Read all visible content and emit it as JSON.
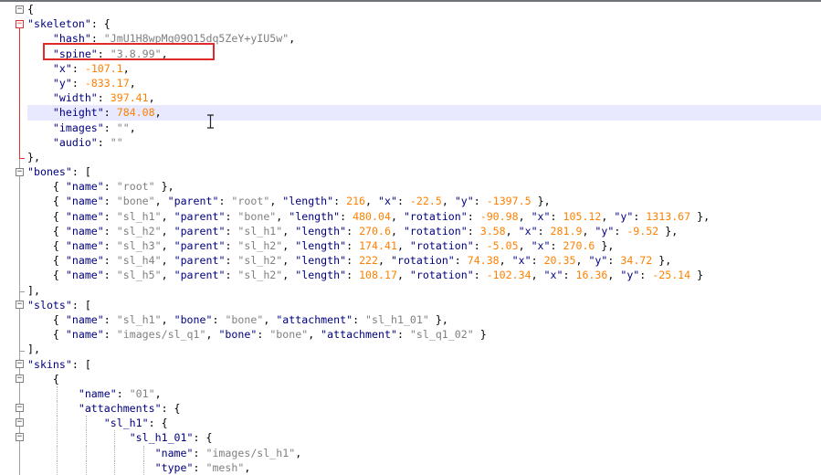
{
  "editor": {
    "lines": [
      {
        "depth": 0,
        "hl": false,
        "tokens": [
          [
            "p",
            "{"
          ]
        ]
      },
      {
        "depth": 0,
        "hl": false,
        "tokens": [
          [
            "k",
            "\"skeleton\""
          ],
          [
            "p",
            ": {"
          ]
        ]
      },
      {
        "depth": 1,
        "hl": false,
        "tokens": [
          [
            "k",
            "\"hash\""
          ],
          [
            "p",
            ": "
          ],
          [
            "s",
            "\"JmU1H8wpMq09O15dq5ZeY+yIU5w\""
          ],
          [
            "p",
            ","
          ]
        ]
      },
      {
        "depth": 1,
        "hl": false,
        "tokens": [
          [
            "k",
            "\"spine\""
          ],
          [
            "p",
            ": "
          ],
          [
            "s",
            "\"3.8.99\""
          ],
          [
            "p",
            ","
          ]
        ]
      },
      {
        "depth": 1,
        "hl": false,
        "tokens": [
          [
            "k",
            "\"x\""
          ],
          [
            "p",
            ": "
          ],
          [
            "n",
            "-107.1"
          ],
          [
            "p",
            ","
          ]
        ]
      },
      {
        "depth": 1,
        "hl": false,
        "tokens": [
          [
            "k",
            "\"y\""
          ],
          [
            "p",
            ": "
          ],
          [
            "n",
            "-833.17"
          ],
          [
            "p",
            ","
          ]
        ]
      },
      {
        "depth": 1,
        "hl": false,
        "tokens": [
          [
            "k",
            "\"width\""
          ],
          [
            "p",
            ": "
          ],
          [
            "n",
            "397.41"
          ],
          [
            "p",
            ","
          ]
        ]
      },
      {
        "depth": 1,
        "hl": true,
        "tokens": [
          [
            "k",
            "\"height\""
          ],
          [
            "p",
            ": "
          ],
          [
            "n",
            "784.08"
          ],
          [
            "p",
            ","
          ]
        ]
      },
      {
        "depth": 1,
        "hl": false,
        "tokens": [
          [
            "k",
            "\"images\""
          ],
          [
            "p",
            ": "
          ],
          [
            "s",
            "\"\""
          ],
          [
            "p",
            ","
          ]
        ]
      },
      {
        "depth": 1,
        "hl": false,
        "tokens": [
          [
            "k",
            "\"audio\""
          ],
          [
            "p",
            ": "
          ],
          [
            "s",
            "\"\""
          ]
        ]
      },
      {
        "depth": 0,
        "hl": false,
        "tokens": [
          [
            "p",
            "},"
          ]
        ]
      },
      {
        "depth": 0,
        "hl": false,
        "tokens": [
          [
            "k",
            "\"bones\""
          ],
          [
            "p",
            ": ["
          ]
        ]
      },
      {
        "depth": 1,
        "hl": false,
        "tokens": [
          [
            "p",
            "{ "
          ],
          [
            "k",
            "\"name\""
          ],
          [
            "p",
            ": "
          ],
          [
            "s",
            "\"root\""
          ],
          [
            "p",
            " },"
          ]
        ]
      },
      {
        "depth": 1,
        "hl": false,
        "tokens": [
          [
            "p",
            "{ "
          ],
          [
            "k",
            "\"name\""
          ],
          [
            "p",
            ": "
          ],
          [
            "s",
            "\"bone\""
          ],
          [
            "p",
            ", "
          ],
          [
            "k",
            "\"parent\""
          ],
          [
            "p",
            ": "
          ],
          [
            "s",
            "\"root\""
          ],
          [
            "p",
            ", "
          ],
          [
            "k",
            "\"length\""
          ],
          [
            "p",
            ": "
          ],
          [
            "n",
            "216"
          ],
          [
            "p",
            ", "
          ],
          [
            "k",
            "\"x\""
          ],
          [
            "p",
            ": "
          ],
          [
            "n",
            "-22.5"
          ],
          [
            "p",
            ", "
          ],
          [
            "k",
            "\"y\""
          ],
          [
            "p",
            ": "
          ],
          [
            "n",
            "-1397.5"
          ],
          [
            "p",
            " },"
          ]
        ]
      },
      {
        "depth": 1,
        "hl": false,
        "tokens": [
          [
            "p",
            "{ "
          ],
          [
            "k",
            "\"name\""
          ],
          [
            "p",
            ": "
          ],
          [
            "s",
            "\"sl_h1\""
          ],
          [
            "p",
            ", "
          ],
          [
            "k",
            "\"parent\""
          ],
          [
            "p",
            ": "
          ],
          [
            "s",
            "\"bone\""
          ],
          [
            "p",
            ", "
          ],
          [
            "k",
            "\"length\""
          ],
          [
            "p",
            ": "
          ],
          [
            "n",
            "480.04"
          ],
          [
            "p",
            ", "
          ],
          [
            "k",
            "\"rotation\""
          ],
          [
            "p",
            ": "
          ],
          [
            "n",
            "-90.98"
          ],
          [
            "p",
            ", "
          ],
          [
            "k",
            "\"x\""
          ],
          [
            "p",
            ": "
          ],
          [
            "n",
            "105.12"
          ],
          [
            "p",
            ", "
          ],
          [
            "k",
            "\"y\""
          ],
          [
            "p",
            ": "
          ],
          [
            "n",
            "1313.67"
          ],
          [
            "p",
            " },"
          ]
        ]
      },
      {
        "depth": 1,
        "hl": false,
        "tokens": [
          [
            "p",
            "{ "
          ],
          [
            "k",
            "\"name\""
          ],
          [
            "p",
            ": "
          ],
          [
            "s",
            "\"sl_h2\""
          ],
          [
            "p",
            ", "
          ],
          [
            "k",
            "\"parent\""
          ],
          [
            "p",
            ": "
          ],
          [
            "s",
            "\"sl_h1\""
          ],
          [
            "p",
            ", "
          ],
          [
            "k",
            "\"length\""
          ],
          [
            "p",
            ": "
          ],
          [
            "n",
            "270.6"
          ],
          [
            "p",
            ", "
          ],
          [
            "k",
            "\"rotation\""
          ],
          [
            "p",
            ": "
          ],
          [
            "n",
            "3.58"
          ],
          [
            "p",
            ", "
          ],
          [
            "k",
            "\"x\""
          ],
          [
            "p",
            ": "
          ],
          [
            "n",
            "281.9"
          ],
          [
            "p",
            ", "
          ],
          [
            "k",
            "\"y\""
          ],
          [
            "p",
            ": "
          ],
          [
            "n",
            "-9.52"
          ],
          [
            "p",
            " },"
          ]
        ]
      },
      {
        "depth": 1,
        "hl": false,
        "tokens": [
          [
            "p",
            "{ "
          ],
          [
            "k",
            "\"name\""
          ],
          [
            "p",
            ": "
          ],
          [
            "s",
            "\"sl_h3\""
          ],
          [
            "p",
            ", "
          ],
          [
            "k",
            "\"parent\""
          ],
          [
            "p",
            ": "
          ],
          [
            "s",
            "\"sl_h2\""
          ],
          [
            "p",
            ", "
          ],
          [
            "k",
            "\"length\""
          ],
          [
            "p",
            ": "
          ],
          [
            "n",
            "174.41"
          ],
          [
            "p",
            ", "
          ],
          [
            "k",
            "\"rotation\""
          ],
          [
            "p",
            ": "
          ],
          [
            "n",
            "-5.05"
          ],
          [
            "p",
            ", "
          ],
          [
            "k",
            "\"x\""
          ],
          [
            "p",
            ": "
          ],
          [
            "n",
            "270.6"
          ],
          [
            "p",
            " },"
          ]
        ]
      },
      {
        "depth": 1,
        "hl": false,
        "tokens": [
          [
            "p",
            "{ "
          ],
          [
            "k",
            "\"name\""
          ],
          [
            "p",
            ": "
          ],
          [
            "s",
            "\"sl_h4\""
          ],
          [
            "p",
            ", "
          ],
          [
            "k",
            "\"parent\""
          ],
          [
            "p",
            ": "
          ],
          [
            "s",
            "\"sl_h2\""
          ],
          [
            "p",
            ", "
          ],
          [
            "k",
            "\"length\""
          ],
          [
            "p",
            ": "
          ],
          [
            "n",
            "222"
          ],
          [
            "p",
            ", "
          ],
          [
            "k",
            "\"rotation\""
          ],
          [
            "p",
            ": "
          ],
          [
            "n",
            "74.38"
          ],
          [
            "p",
            ", "
          ],
          [
            "k",
            "\"x\""
          ],
          [
            "p",
            ": "
          ],
          [
            "n",
            "20.35"
          ],
          [
            "p",
            ", "
          ],
          [
            "k",
            "\"y\""
          ],
          [
            "p",
            ": "
          ],
          [
            "n",
            "34.72"
          ],
          [
            "p",
            " },"
          ]
        ]
      },
      {
        "depth": 1,
        "hl": false,
        "tokens": [
          [
            "p",
            "{ "
          ],
          [
            "k",
            "\"name\""
          ],
          [
            "p",
            ": "
          ],
          [
            "s",
            "\"sl_h5\""
          ],
          [
            "p",
            ", "
          ],
          [
            "k",
            "\"parent\""
          ],
          [
            "p",
            ": "
          ],
          [
            "s",
            "\"sl_h2\""
          ],
          [
            "p",
            ", "
          ],
          [
            "k",
            "\"length\""
          ],
          [
            "p",
            ": "
          ],
          [
            "n",
            "108.17"
          ],
          [
            "p",
            ", "
          ],
          [
            "k",
            "\"rotation\""
          ],
          [
            "p",
            ": "
          ],
          [
            "n",
            "-102.34"
          ],
          [
            "p",
            ", "
          ],
          [
            "k",
            "\"x\""
          ],
          [
            "p",
            ": "
          ],
          [
            "n",
            "16.36"
          ],
          [
            "p",
            ", "
          ],
          [
            "k",
            "\"y\""
          ],
          [
            "p",
            ": "
          ],
          [
            "n",
            "-25.14"
          ],
          [
            "p",
            " }"
          ]
        ]
      },
      {
        "depth": 0,
        "hl": false,
        "tokens": [
          [
            "p",
            "],"
          ]
        ]
      },
      {
        "depth": 0,
        "hl": false,
        "tokens": [
          [
            "k",
            "\"slots\""
          ],
          [
            "p",
            ": ["
          ]
        ]
      },
      {
        "depth": 1,
        "hl": false,
        "tokens": [
          [
            "p",
            "{ "
          ],
          [
            "k",
            "\"name\""
          ],
          [
            "p",
            ": "
          ],
          [
            "s",
            "\"sl_h1\""
          ],
          [
            "p",
            ", "
          ],
          [
            "k",
            "\"bone\""
          ],
          [
            "p",
            ": "
          ],
          [
            "s",
            "\"bone\""
          ],
          [
            "p",
            ", "
          ],
          [
            "k",
            "\"attachment\""
          ],
          [
            "p",
            ": "
          ],
          [
            "s",
            "\"sl_h1_01\""
          ],
          [
            "p",
            " },"
          ]
        ]
      },
      {
        "depth": 1,
        "hl": false,
        "tokens": [
          [
            "p",
            "{ "
          ],
          [
            "k",
            "\"name\""
          ],
          [
            "p",
            ": "
          ],
          [
            "s",
            "\"images/sl_q1\""
          ],
          [
            "p",
            ", "
          ],
          [
            "k",
            "\"bone\""
          ],
          [
            "p",
            ": "
          ],
          [
            "s",
            "\"bone\""
          ],
          [
            "p",
            ", "
          ],
          [
            "k",
            "\"attachment\""
          ],
          [
            "p",
            ": "
          ],
          [
            "s",
            "\"sl_q1_02\""
          ],
          [
            "p",
            " }"
          ]
        ]
      },
      {
        "depth": 0,
        "hl": false,
        "tokens": [
          [
            "p",
            "],"
          ]
        ]
      },
      {
        "depth": 0,
        "hl": false,
        "tokens": [
          [
            "k",
            "\"skins\""
          ],
          [
            "p",
            ": ["
          ]
        ]
      },
      {
        "depth": 1,
        "hl": false,
        "tokens": [
          [
            "p",
            "{"
          ]
        ]
      },
      {
        "depth": 2,
        "hl": false,
        "tokens": [
          [
            "k",
            "\"name\""
          ],
          [
            "p",
            ": "
          ],
          [
            "s",
            "\"01\""
          ],
          [
            "p",
            ","
          ]
        ]
      },
      {
        "depth": 2,
        "hl": false,
        "tokens": [
          [
            "k",
            "\"attachments\""
          ],
          [
            "p",
            ": {"
          ]
        ]
      },
      {
        "depth": 3,
        "hl": false,
        "tokens": [
          [
            "k",
            "\"sl_h1\""
          ],
          [
            "p",
            ": {"
          ]
        ]
      },
      {
        "depth": 4,
        "hl": false,
        "tokens": [
          [
            "k",
            "\"sl_h1_01\""
          ],
          [
            "p",
            ": {"
          ]
        ]
      },
      {
        "depth": 5,
        "hl": false,
        "tokens": [
          [
            "k",
            "\"name\""
          ],
          [
            "p",
            ": "
          ],
          [
            "s",
            "\"images/sl_h1\""
          ],
          [
            "p",
            ","
          ]
        ]
      },
      {
        "depth": 5,
        "hl": false,
        "tokens": [
          [
            "k",
            "\"type\""
          ],
          [
            "p",
            ": "
          ],
          [
            "s",
            "\"mesh\""
          ],
          [
            "p",
            ","
          ]
        ]
      }
    ]
  },
  "annotation": {
    "color": "#e02a2a"
  }
}
